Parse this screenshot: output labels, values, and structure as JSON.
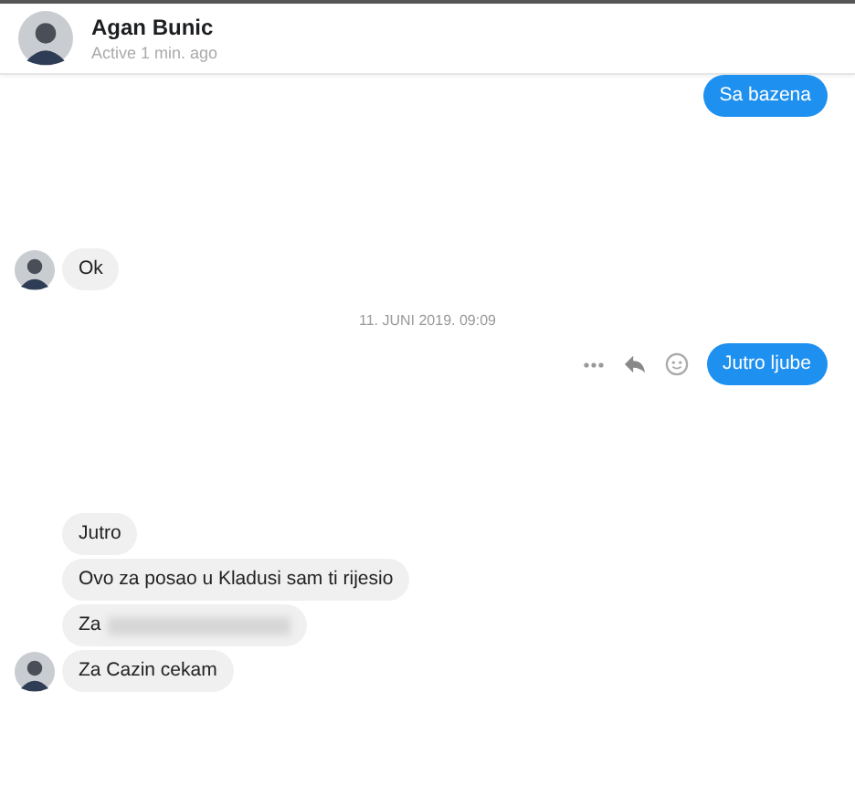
{
  "header": {
    "name": "Agan Bunic",
    "status": "Active 1 min. ago"
  },
  "groups": [
    {
      "kind": "outgoing",
      "messages": [
        {
          "text": "Sa bazena"
        }
      ],
      "actions": false
    },
    {
      "kind": "incoming",
      "messages": [
        {
          "text": "Ok",
          "redacted": false
        }
      ]
    },
    {
      "kind": "timestamp",
      "text": "11. JUNI 2019. 09:09"
    },
    {
      "kind": "outgoing",
      "messages": [
        {
          "text": "Jutro ljube"
        }
      ],
      "actions": true
    },
    {
      "kind": "incoming",
      "messages": [
        {
          "text": "Jutro",
          "redacted": false
        },
        {
          "text": "Ovo za posao u Kladusi sam ti rijesio",
          "redacted": false
        },
        {
          "text": "Za",
          "redacted": true
        },
        {
          "text": "Za Cazin cekam",
          "redacted": false
        }
      ]
    }
  ]
}
